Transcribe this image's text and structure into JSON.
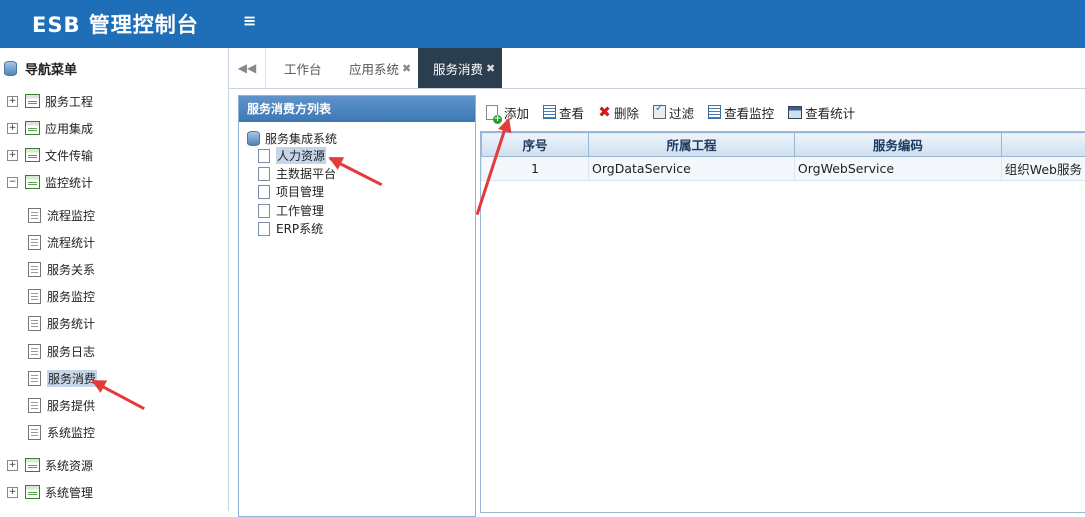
{
  "app": {
    "title": "ESB 管理控制台",
    "menu_toggle": "≡"
  },
  "sidebar": {
    "title": "导航菜单",
    "groups": [
      {
        "label": "服务工程",
        "expander": "+"
      },
      {
        "label": "应用集成",
        "expander": "+"
      },
      {
        "label": "文件传输",
        "expander": "+"
      },
      {
        "label": "监控统计",
        "expander": "−"
      },
      {
        "label": "系统资源",
        "expander": "+"
      },
      {
        "label": "系统管理",
        "expander": "+"
      }
    ],
    "children": [
      "流程监控",
      "流程统计",
      "服务关系",
      "服务监控",
      "服务统计",
      "服务日志",
      "服务消费",
      "服务提供",
      "系统监控"
    ],
    "selected": "服务消费"
  },
  "tabs": {
    "scroll": "◀◀",
    "items": [
      {
        "label": "工作台",
        "close": ""
      },
      {
        "label": "应用系统",
        "close": "✖"
      },
      {
        "label": "服务消费",
        "close": "✖"
      }
    ],
    "active": "服务消费"
  },
  "consumer_panel": {
    "title": "服务消费方列表",
    "root": "服务集成系统",
    "items": [
      "人力资源",
      "主数据平台",
      "项目管理",
      "工作管理",
      "ERP系统"
    ],
    "selected": "人力资源"
  },
  "toolbar": {
    "add": "添加",
    "view": "查看",
    "delete": "删除",
    "filter": "过滤",
    "view_monitor": "查看监控",
    "view_stats": "查看统计"
  },
  "grid": {
    "columns": [
      "序号",
      "所属工程",
      "服务编码",
      ""
    ],
    "rows": [
      [
        "1",
        "OrgDataService",
        "OrgWebService",
        "组织Web服务"
      ]
    ]
  },
  "colors": {
    "header": "#1e6fb8",
    "tab_active": "#2b3e4f",
    "arrow": "#e43a3a"
  }
}
